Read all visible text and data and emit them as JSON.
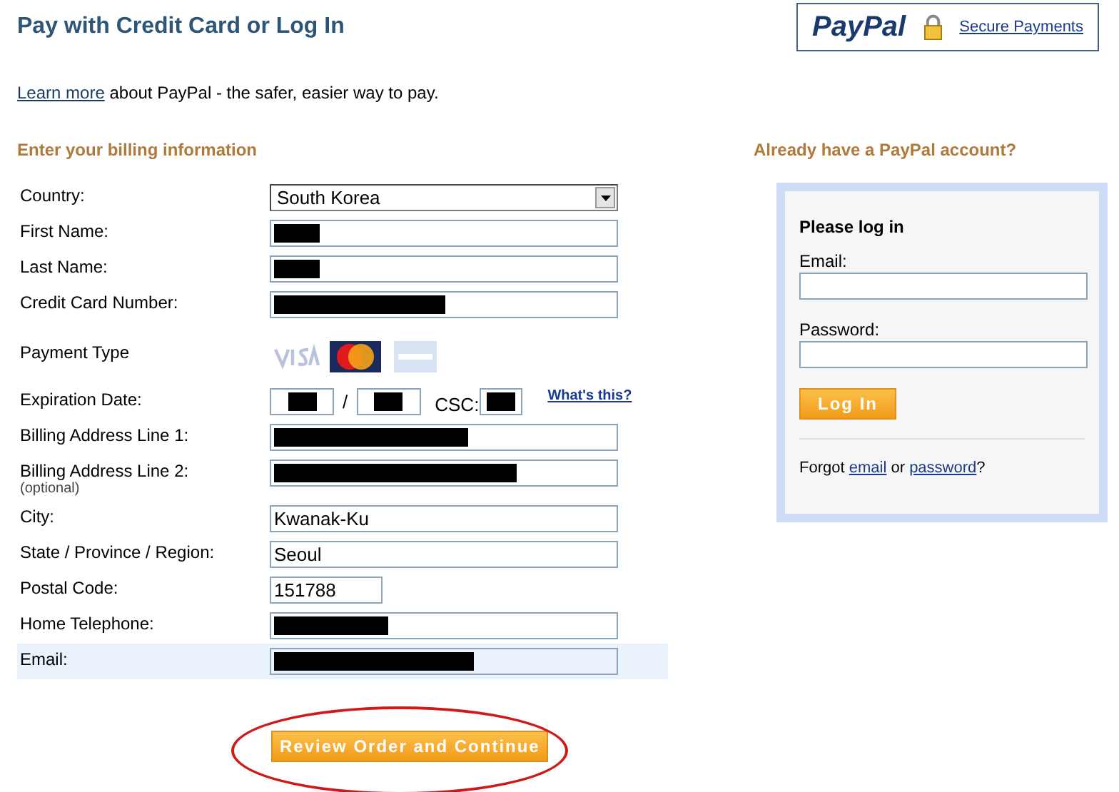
{
  "header": {
    "title": "Pay with Credit Card or Log In",
    "logo": "PayPal",
    "secure_link": "Secure Payments"
  },
  "intro": {
    "link": "Learn more",
    "text": "about PayPal - the safer, easier way to pay."
  },
  "billing": {
    "heading": "Enter your billing information",
    "rows": [
      {
        "kind": "select",
        "label": "Country:",
        "value": "South Korea",
        "highlighted": false
      },
      {
        "kind": "text",
        "label": "First Name:",
        "redacted": true,
        "highlighted": false
      },
      {
        "kind": "text",
        "label": "Last Name:",
        "redacted": true,
        "highlighted": false
      },
      {
        "kind": "text",
        "label": "Credit Card Number:",
        "redacted": true,
        "highlighted": false
      },
      {
        "kind": "cards",
        "label": "Payment Type",
        "cards": [
          {
            "selected": false
          },
          {
            "selected": true
          },
          {
            "selected": false
          }
        ],
        "highlighted": false
      },
      {
        "kind": "expiry",
        "label": "Expiration Date:",
        "separator": "/",
        "csc_label": "CSC:",
        "help_link": "What's this?",
        "highlighted": false
      },
      {
        "kind": "text",
        "label": "Billing Address Line 1:",
        "redacted": true,
        "highlighted": false
      },
      {
        "kind": "text",
        "label": "Billing Address Line 2:",
        "note": "(optional)",
        "redacted": true,
        "highlighted": false
      },
      {
        "kind": "text",
        "label": "City:",
        "value": "Kwanak-Ku",
        "highlighted": false
      },
      {
        "kind": "text",
        "label": "State / Province / Region:",
        "value": "Seoul",
        "highlighted": false
      },
      {
        "kind": "short",
        "label": "Postal Code:",
        "value": "151788",
        "highlighted": false
      },
      {
        "kind": "text",
        "label": "Home Telephone:",
        "redacted": true,
        "highlighted": false
      },
      {
        "kind": "text",
        "label": "Email:",
        "redacted": true,
        "highlighted": true
      }
    ],
    "submit": "Review Order and Continue",
    "submit_circled": true
  },
  "login": {
    "heading": "Already have a PayPal account?",
    "title": "Please log in",
    "email_label": "Email:",
    "password_label": "Password:",
    "button": "Log In",
    "forgot": {
      "text": "Forgot",
      "email_link": "email",
      "or": "or",
      "password_link": "password",
      "end": "?"
    }
  }
}
